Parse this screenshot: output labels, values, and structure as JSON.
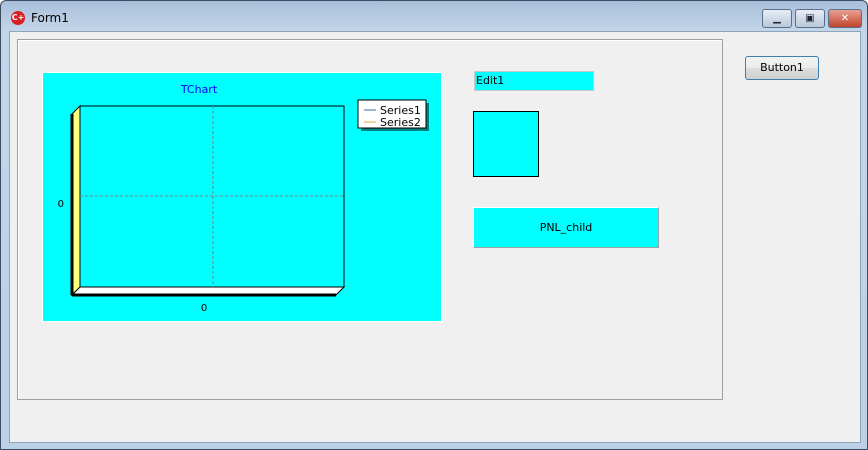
{
  "window": {
    "title": "Form1",
    "app_icon": "cpp-builder-icon",
    "minimize": "minimize-icon",
    "maximize": "maximize-icon",
    "close": "close-icon"
  },
  "edit": {
    "value": "Edit1"
  },
  "panel_child": {
    "label": "PNL_child"
  },
  "button": {
    "label": "Button1"
  },
  "chart_data": {
    "type": "line",
    "title": "TChart",
    "x_tick_labels": [
      "0"
    ],
    "y_tick_labels": [
      "0"
    ],
    "legend_position": "top-right",
    "series": [
      {
        "name": "Series1",
        "color": "#4a6aa8",
        "values": []
      },
      {
        "name": "Series2",
        "color": "#f0a040",
        "values": []
      }
    ],
    "grid": true,
    "view3d": true
  }
}
